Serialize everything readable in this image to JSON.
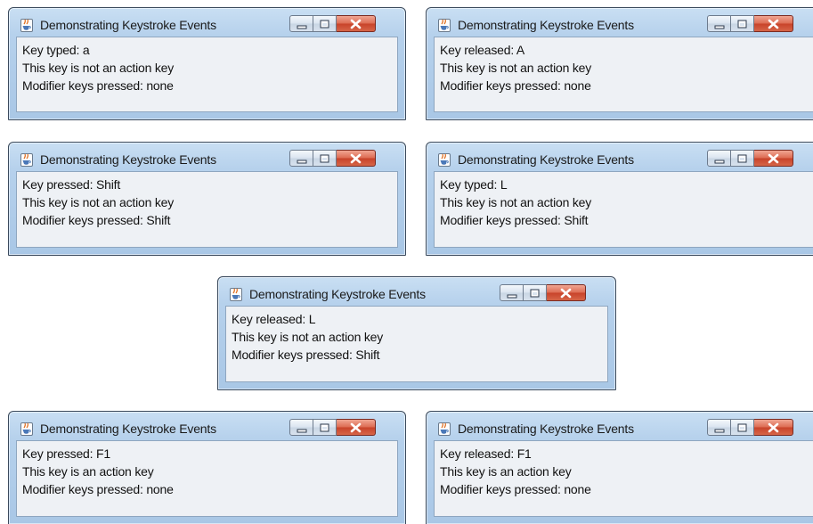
{
  "window_title": "Demonstrating Keystroke Events",
  "window_icon": "java-coffee-cup-icon",
  "windows": [
    {
      "lines": [
        "Key typed: a",
        "This key is not an action key",
        "Modifier keys pressed: none"
      ]
    },
    {
      "lines": [
        "Key released: A",
        "This key is not an action key",
        "Modifier keys pressed: none"
      ]
    },
    {
      "lines": [
        "Key pressed: Shift",
        "This key is not an action key",
        "Modifier keys pressed: Shift"
      ]
    },
    {
      "lines": [
        "Key typed: L",
        "This key is not an action key",
        "Modifier keys pressed: Shift"
      ]
    },
    {
      "lines": [
        "Key released: L",
        "This key is not an action key",
        "Modifier keys pressed: Shift"
      ]
    },
    {
      "lines": [
        "Key pressed: F1",
        "This key is an action key",
        "Modifier keys pressed: none"
      ]
    },
    {
      "lines": [
        "Key released: F1",
        "This key is an action key",
        "Modifier keys pressed: none"
      ]
    }
  ],
  "colors": {
    "frame": "#b6d1ec",
    "close_button": "#c8432a",
    "content_background": "#eef1f5"
  }
}
